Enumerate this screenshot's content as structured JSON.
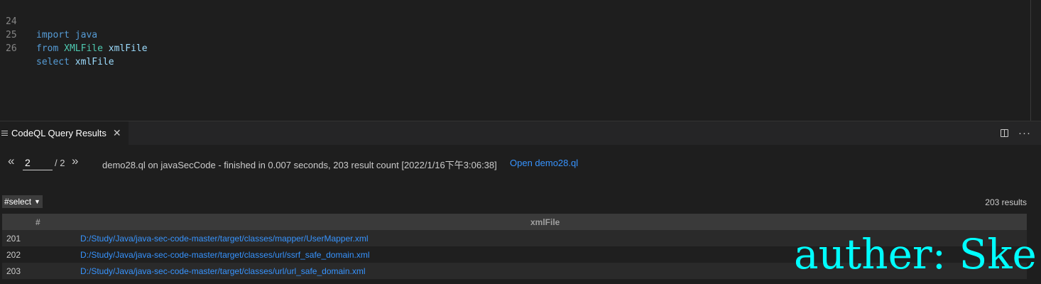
{
  "editor": {
    "lines": [
      {
        "num": "24",
        "kw": "import",
        "rest1": "",
        "rest2": " java"
      },
      {
        "num": "25",
        "kw": "from",
        "rest1": " XMLFile",
        "rest2": " xmlFile"
      },
      {
        "num": "26",
        "kw": "select",
        "rest1": "",
        "rest2": " xmlFile"
      }
    ]
  },
  "panel": {
    "tab_title": "CodeQL Query Results",
    "tab_close": "✕",
    "more": "···"
  },
  "nav": {
    "prev": "«",
    "next": "»",
    "page_value": "2",
    "page_total": "/ 2",
    "query_info": "demo28.ql on javaSecCode - finished in 0.007 seconds, 203 result count [2022/1/16下午3:06:38]",
    "open_link": "Open demo28.ql"
  },
  "results": {
    "select_label": "#select",
    "count_label": "203 results",
    "columns": [
      "#",
      "xmlFile"
    ],
    "rows": [
      {
        "num": "201",
        "path": "D:/Study/Java/java-sec-code-master/target/classes/mapper/UserMapper.xml"
      },
      {
        "num": "202",
        "path": "D:/Study/Java/java-sec-code-master/target/classes/url/ssrf_safe_domain.xml"
      },
      {
        "num": "203",
        "path": "D:/Study/Java/java-sec-code-master/target/classes/url/url_safe_domain.xml"
      }
    ]
  },
  "watermark": "auther: Ske",
  "colors": {
    "link": "#3794ff",
    "keyword": "#569cd6",
    "type": "#4ec9b0",
    "watermark": "#00ffff"
  }
}
